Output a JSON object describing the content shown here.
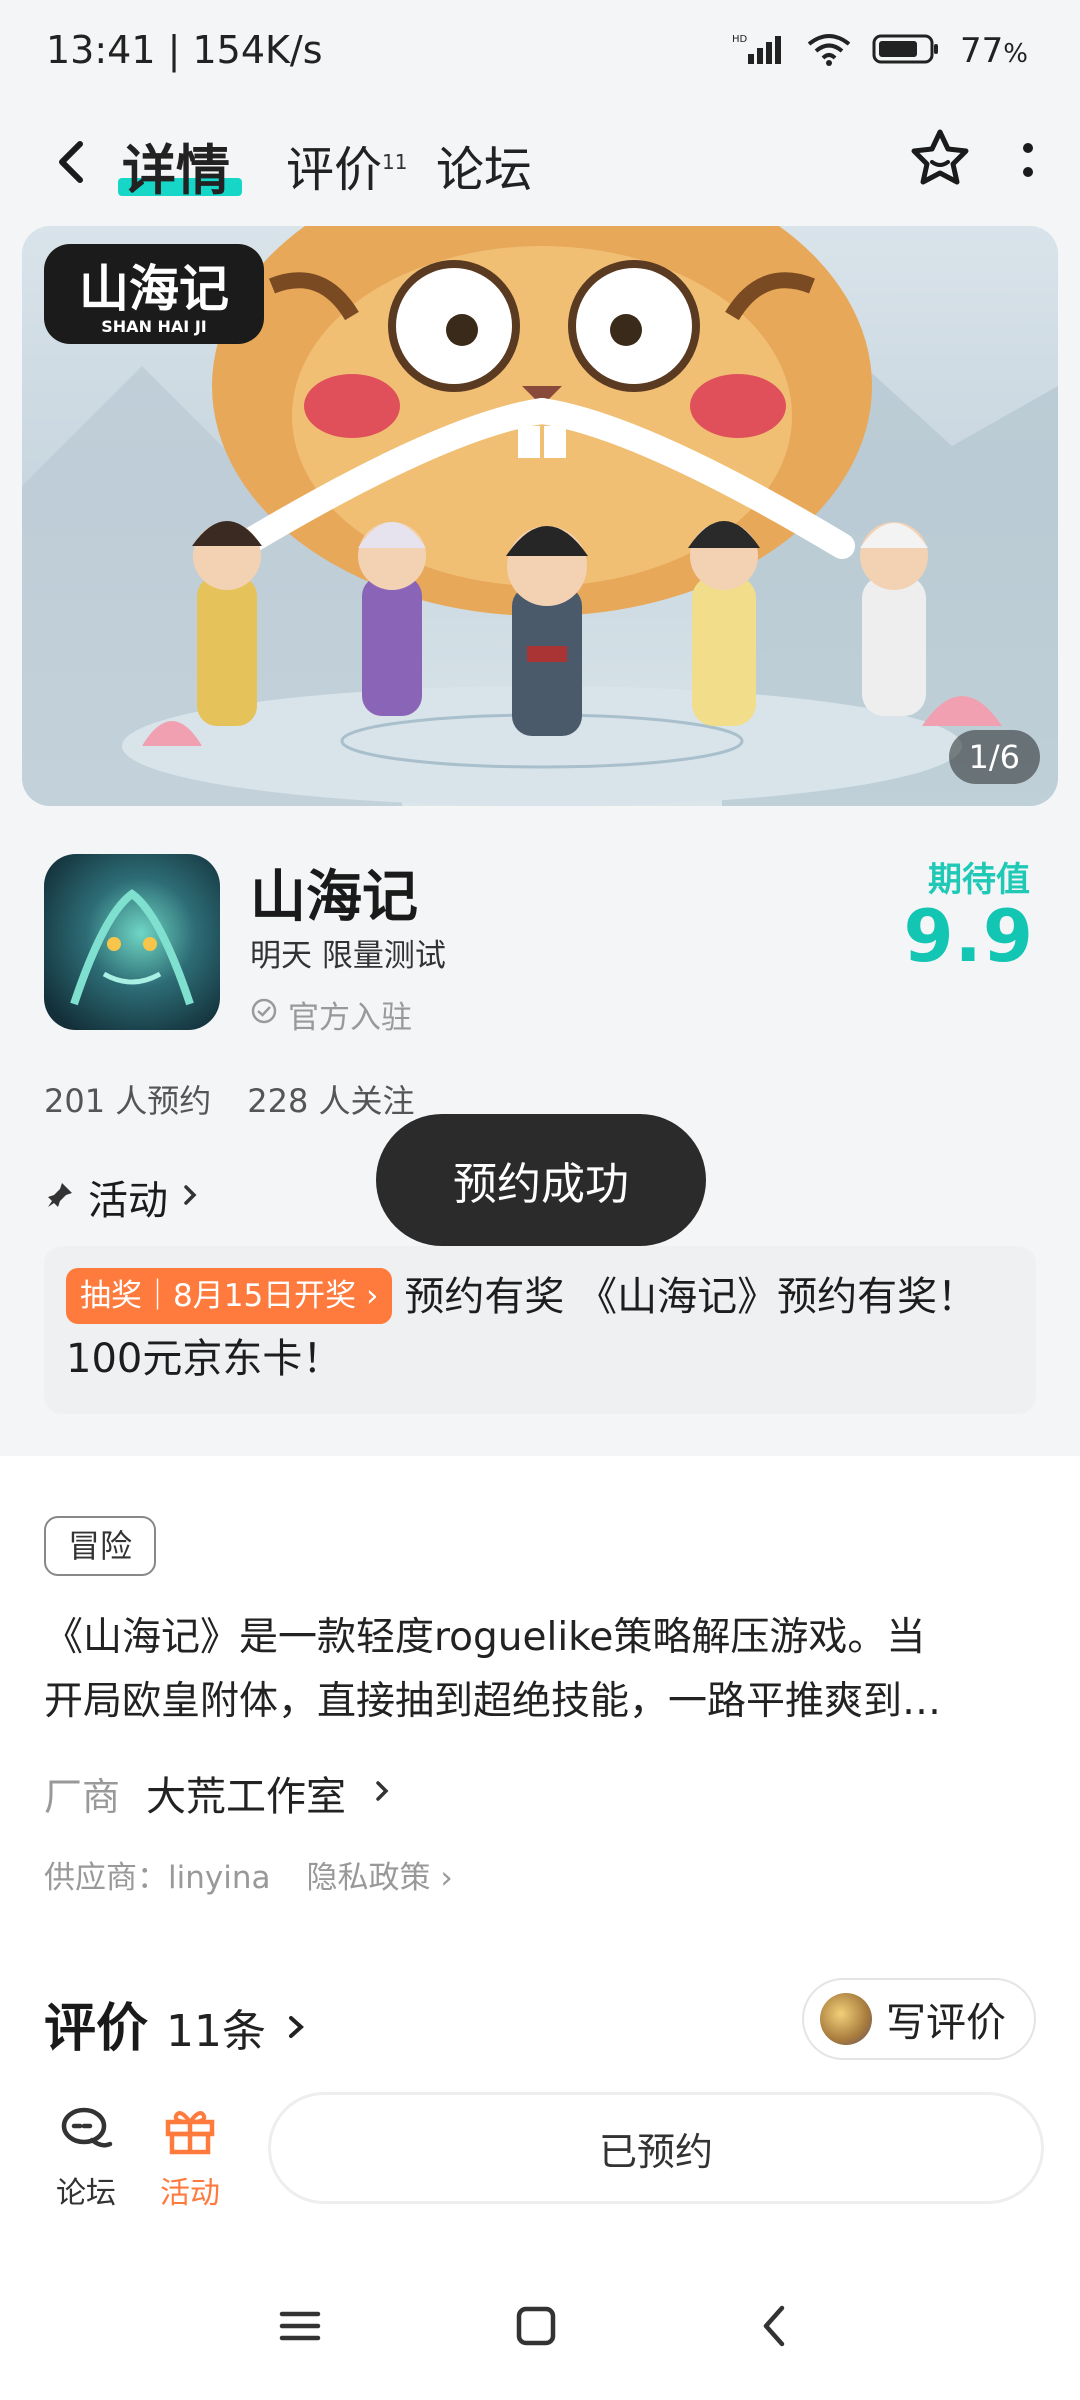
{
  "status_bar": {
    "time": "13:41 | 154K/s",
    "battery_percent": "77"
  },
  "nav": {
    "tabs": [
      {
        "label": "详情",
        "active": true
      },
      {
        "label": "评价",
        "badge": "11"
      },
      {
        "label": "论坛"
      }
    ],
    "icons": [
      "back-icon",
      "star-icon",
      "more-icon"
    ]
  },
  "banner": {
    "logo_text_cn": "山海记",
    "logo_text_en": "SHAN HAI JI",
    "counter": "1/6"
  },
  "game": {
    "title": "山海记",
    "subtitle": "明天 限量测试",
    "official": "官方入驻",
    "expect_label": "期待值",
    "expect_score": "9.9"
  },
  "stats": {
    "reservations": "201 人预约",
    "followers": "228 人关注"
  },
  "activity": {
    "label": "活动",
    "tag": "抽奖｜8月15日开奖",
    "text": "预约有奖 《山海记》预约有奖！100元京东卡！"
  },
  "toast": "预约成功",
  "description": {
    "genre": "冒险",
    "line1": "《山海记》是一款轻度roguelike策略解压游戏。当",
    "line2": "开局欧皇附体，直接抽到超绝技能，一路平推爽到…"
  },
  "vendor": {
    "label": "厂商",
    "name": "大荒工作室"
  },
  "supplier": {
    "text": "供应商：linyina",
    "privacy": "隐私政策"
  },
  "reviews": {
    "title": "评价",
    "count": "11条",
    "write_button": "写评价"
  },
  "action_bar": {
    "forum_label": "论坛",
    "activity_label": "活动",
    "reserved_label": "已预约"
  },
  "colors": {
    "accent_teal": "#16d6c8",
    "accent_orange": "#ff7a3d",
    "score_teal": "#12c6b3"
  }
}
